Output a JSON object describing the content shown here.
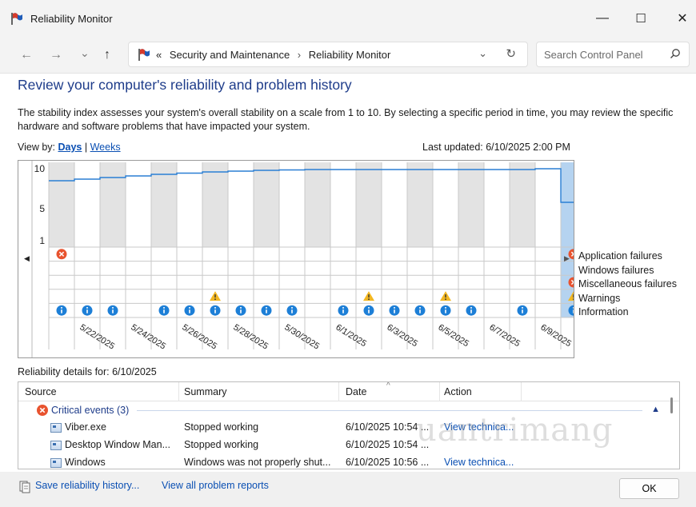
{
  "window": {
    "title": "Reliability Monitor",
    "minimize": "—",
    "maximize": "☐",
    "close": "✕"
  },
  "nav": {
    "back": "←",
    "forward": "→",
    "recent": "⌄",
    "up": "↑",
    "breadcrumb_prefix": "«",
    "crumbs": [
      "Security and Maintenance",
      "Reliability Monitor"
    ],
    "crumb_sep": "›",
    "dropdown": "⌄",
    "refresh": "↻",
    "search_placeholder": "Search Control Panel"
  },
  "heading": "Review your computer's reliability and problem history",
  "description": "The stability index assesses your system's overall stability on a scale from 1 to 10. By selecting a specific period in time, you may review the specific hardware and software problems that have impacted your system.",
  "view_by": {
    "label": "View by:",
    "days": "Days",
    "sep": "|",
    "weeks": "Weeks"
  },
  "last_updated": "Last updated: 6/10/2025 2:00 PM",
  "chart": {
    "y_ticks": [
      "10",
      "5",
      "1"
    ],
    "date_labels": [
      "5/22/2025",
      "5/24/2025",
      "5/26/2025",
      "5/28/2025",
      "5/30/2025",
      "6/1/2025",
      "6/3/2025",
      "6/5/2025",
      "6/7/2025",
      "6/9/2025"
    ],
    "legend": [
      "Application failures",
      "Windows failures",
      "Miscellaneous failures",
      "Warnings",
      "Information"
    ]
  },
  "chart_data": {
    "type": "line",
    "days": [
      "5/21/2025",
      "5/22/2025",
      "5/23/2025",
      "5/24/2025",
      "5/25/2025",
      "5/26/2025",
      "5/27/2025",
      "5/28/2025",
      "5/29/2025",
      "5/30/2025",
      "5/31/2025",
      "6/1/2025",
      "6/2/2025",
      "6/3/2025",
      "6/4/2025",
      "6/5/2025",
      "6/6/2025",
      "6/7/2025",
      "6/8/2025",
      "6/9/2025",
      "6/10/2025"
    ],
    "stability_index": [
      8.5,
      8.7,
      8.9,
      9.1,
      9.3,
      9.45,
      9.6,
      9.7,
      9.8,
      9.85,
      9.9,
      9.9,
      9.9,
      9.9,
      9.9,
      9.9,
      9.9,
      9.9,
      9.9,
      10,
      5.8
    ],
    "selected_day": "6/10/2025",
    "ylim": [
      1,
      10
    ],
    "events": {
      "application_failures": [
        0,
        20
      ],
      "windows_failures": [],
      "misc_failures": [
        20
      ],
      "warnings": [
        6,
        12,
        15,
        20
      ],
      "information": [
        0,
        1,
        2,
        4,
        5,
        6,
        7,
        8,
        9,
        11,
        12,
        13,
        14,
        15,
        16,
        18,
        20
      ]
    }
  },
  "details": {
    "label": "Reliability details for: 6/10/2025",
    "columns": [
      "Source",
      "Summary",
      "Date",
      "Action"
    ],
    "group": "Critical events (3)",
    "rows": [
      {
        "source": "Viber.exe",
        "summary": "Stopped working",
        "date": "6/10/2025 10:54 ...",
        "action": "View technica..."
      },
      {
        "source": "Desktop Window Man...",
        "summary": "Stopped working",
        "date": "6/10/2025 10:54 ...",
        "action": ""
      },
      {
        "source": "Windows",
        "summary": "Windows was not properly shut...",
        "date": "6/10/2025 10:56 ...",
        "action": "View technica..."
      }
    ]
  },
  "footer": {
    "save": "Save reliability history...",
    "view_all": "View all problem reports",
    "ok": "OK"
  },
  "watermark": "uantrimang",
  "colors": {
    "heading": "#1e3c8a",
    "link": "#0a4fb3",
    "line": "#2a7fd4",
    "selected_column": "#b5d3f0",
    "error": "#e8532f",
    "warning": "#f2b722",
    "info": "#1d7fd7"
  }
}
